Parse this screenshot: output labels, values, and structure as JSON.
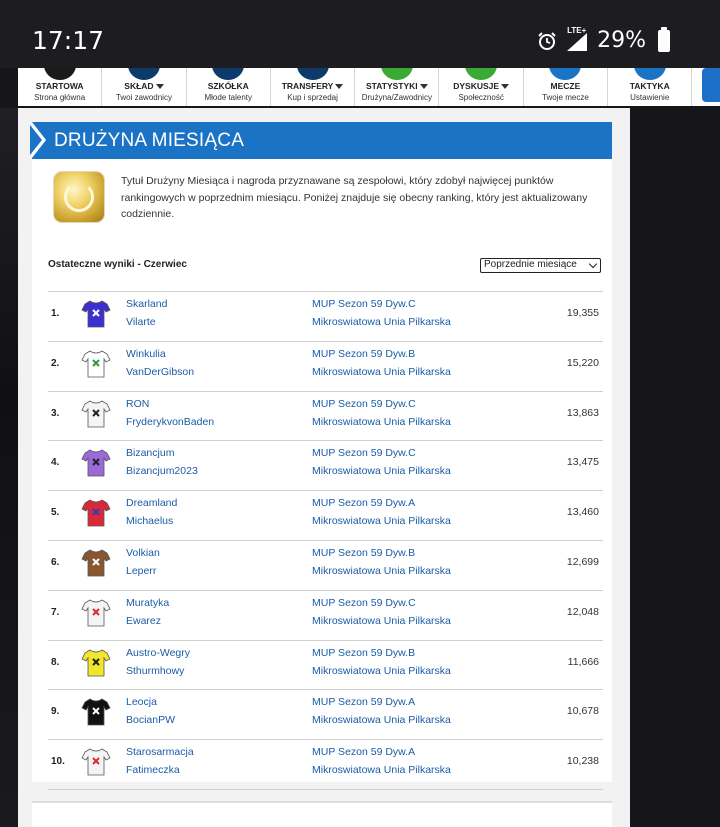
{
  "status_bar": {
    "time": "17:17",
    "battery_percent": "29%",
    "network": "LTE+",
    "icons": [
      "alarm-icon",
      "signal-icon",
      "battery-icon"
    ]
  },
  "nav": {
    "items": [
      {
        "label": "STARTOWA",
        "sub": "Strona główna",
        "has_caret": false,
        "icon_color": "#1a1a1a"
      },
      {
        "label": "SKŁAD",
        "sub": "Twoi zawodnicy",
        "has_caret": true,
        "icon_color": "#0d3a6b"
      },
      {
        "label": "SZKÓŁKA",
        "sub": "Młode talenty",
        "has_caret": false,
        "icon_color": "#0d3a6b"
      },
      {
        "label": "TRANSFERY",
        "sub": "Kup i sprzedaj",
        "has_caret": true,
        "icon_color": "#0d3a6b"
      },
      {
        "label": "STATYSTYKI",
        "sub": "Drużyna/Zawodnicy",
        "has_caret": true,
        "icon_color": "#3aaa35"
      },
      {
        "label": "DYSKUSJE",
        "sub": "Społeczność",
        "has_caret": true,
        "icon_color": "#3aaa35"
      },
      {
        "label": "MECZE",
        "sub": "Twoje mecze",
        "has_caret": false,
        "icon_color": "#1b73c6"
      },
      {
        "label": "TAKTYKA",
        "sub": "Ustawienie",
        "has_caret": false,
        "icon_color": "#1b73c6"
      }
    ]
  },
  "panel": {
    "title": "DRUŻYNA MIESIĄCA",
    "intro": "Tytuł Drużyny Miesiąca i nagroda przyznawane są zespołowi, który zdobył najwięcej punktów rankingowych w poprzednim miesiącu. Poniżej znajduje się obecny ranking, który jest aktualizowany codziennie.",
    "results_title": "Ostateczne wyniki - Czerwiec",
    "month_select": "Poprzednie miesiące"
  },
  "ranking": [
    {
      "rank": "1.",
      "team": "Skarland",
      "manager": "Vilarte",
      "league": "MUP Sezon 59 Dyw.C",
      "association": "Mikroswiatowa Unia Pilkarska",
      "points": "19,355",
      "kit_color": "#3b2fd1",
      "kit_accent": "#ffffff"
    },
    {
      "rank": "2.",
      "team": "Winkulia",
      "manager": "VanDerGibson",
      "league": "MUP Sezon 59 Dyw.B",
      "association": "Mikroswiatowa Unia Pilkarska",
      "points": "15,220",
      "kit_color": "#ffffff",
      "kit_accent": "#2a9a3a"
    },
    {
      "rank": "3.",
      "team": "RON",
      "manager": "FryderykvonBaden",
      "league": "MUP Sezon 59 Dyw.C",
      "association": "Mikroswiatowa Unia Pilkarska",
      "points": "13,863",
      "kit_color": "#f4f4f4",
      "kit_accent": "#222222"
    },
    {
      "rank": "4.",
      "team": "Bizancjum",
      "manager": "Bizancjum2023",
      "league": "MUP Sezon 59 Dyw.C",
      "association": "Mikroswiatowa Unia Pilkarska",
      "points": "13,475",
      "kit_color": "#9a6ad8",
      "kit_accent": "#222222"
    },
    {
      "rank": "5.",
      "team": "Dreamland",
      "manager": "Michaelus",
      "league": "MUP Sezon 59 Dyw.A",
      "association": "Mikroswiatowa Unia Pilkarska",
      "points": "13,460",
      "kit_color": "#d9283a",
      "kit_accent": "#2a3fb0"
    },
    {
      "rank": "6.",
      "team": "Volkian",
      "manager": "Leperr",
      "league": "MUP Sezon 59 Dyw.B",
      "association": "Mikroswiatowa Unia Pilkarska",
      "points": "12,699",
      "kit_color": "#8a5630",
      "kit_accent": "#ffffff"
    },
    {
      "rank": "7.",
      "team": "Muratyka",
      "manager": "Ewarez",
      "league": "MUP Sezon 59 Dyw.C",
      "association": "Mikroswiatowa Unia Pilkarska",
      "points": "12,048",
      "kit_color": "#f4f4f4",
      "kit_accent": "#d9283a"
    },
    {
      "rank": "8.",
      "team": "Austro-Wegry",
      "manager": "Sthurmhowy",
      "league": "MUP Sezon 59 Dyw.B",
      "association": "Mikroswiatowa Unia Pilkarska",
      "points": "11,666",
      "kit_color": "#f0e62a",
      "kit_accent": "#222222"
    },
    {
      "rank": "9.",
      "team": "Leocja",
      "manager": "BocianPW",
      "league": "MUP Sezon 59 Dyw.A",
      "association": "Mikroswiatowa Unia Pilkarska",
      "points": "10,678",
      "kit_color": "#111111",
      "kit_accent": "#ffffff"
    },
    {
      "rank": "10.",
      "team": "Starosarmacja",
      "manager": "Fatimeczka",
      "league": "MUP Sezon 59 Dyw.A",
      "association": "Mikroswiatowa Unia Pilkarska",
      "points": "10,238",
      "kit_color": "#f4f4f4",
      "kit_accent": "#d9283a"
    }
  ]
}
